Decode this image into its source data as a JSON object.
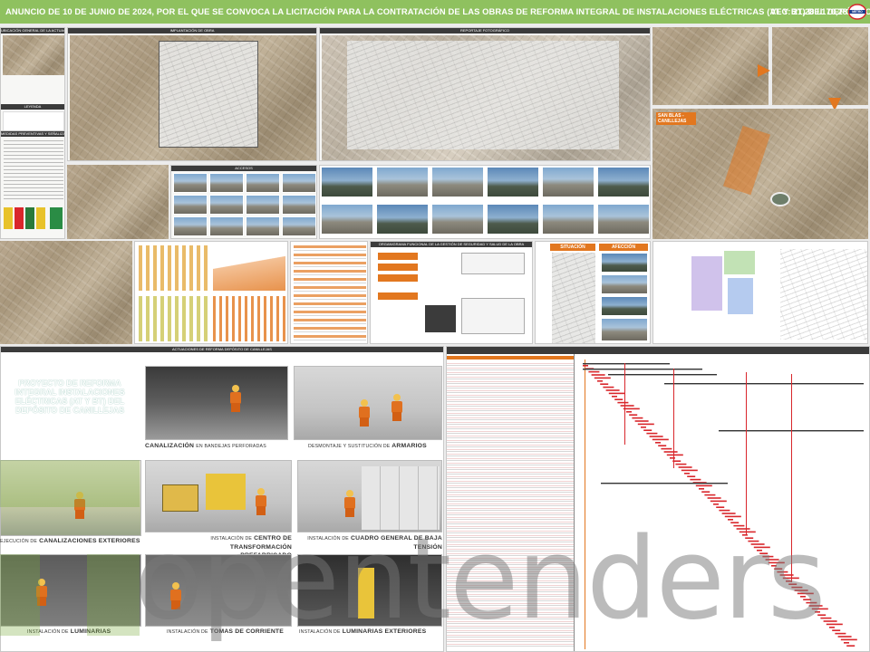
{
  "header": {
    "title": "ANUNCIO DE 10 DE JUNIO DE 2024, POR EL QUE SE CONVOCA LA LICITACIÓN PARA LA CONTRATACIÓN DE LAS OBRAS DE REFORMA INTEGRAL DE INSTALACIONES ELÉCTRICAS (AT Y BT) DEL DEPÓSITO DE CANILLEJAS",
    "vec": "VEC: 21.289.170,28 €",
    "brand_color": "#8fc15f",
    "accent_color": "#e2771f",
    "logo_icon": "metro-madrid-logo"
  },
  "panels": {
    "location_title": "UBICACIÓN GENERAL DE LA ACTUACIÓN",
    "implantation_title": "IMPLANTACIÓN DE OBRA",
    "photo_report_title": "REPORTAJE FOTOGRÁFICO",
    "access_title": "ACCESOS",
    "org_title": "ORGANIGRAMA FUNCIONAL DE LA GESTIÓN DE SEGURIDAD Y SALUD DE LA OBRA",
    "situation_title": "SITUACIÓN",
    "affection_title": "AFECCIÓN",
    "actuations_title": "ACTUACIONES DE REFORMA DEPÓSITO DE CANILLEJAS",
    "legend_title": "LEYENDA",
    "signage_title": "MEDIDAS PREVENTIVAS Y SEÑALIZACIÓN"
  },
  "map_labels": {
    "san_blas": "SAN BLAS - CANILLEJAS"
  },
  "project": {
    "title": "PROYECTO DE REFORMA INTEGRAL INSTALACIONES ELÉCTRICAS (AT Y BT) DEL DEPÓSITO DE CANILLEJAS"
  },
  "works": [
    {
      "prefix": "",
      "label": "CANALIZACIÓN",
      "suffix": "EN BANDEJAS PERFORADAS"
    },
    {
      "prefix": "DESMONTAJE Y SUSTITUCIÓN DE",
      "label": "ARMARIOS",
      "suffix": ""
    },
    {
      "prefix": "EJECUCIÓN DE",
      "label": "CANALIZACIONES EXTERIORES",
      "suffix": ""
    },
    {
      "prefix": "INSTALACIÓN DE",
      "label": "CENTRO DE TRANSFORMACIÓN PREFABRICADO",
      "suffix": ""
    },
    {
      "prefix": "INSTALACIÓN DE",
      "label": "CUADRO GENERAL DE BAJA TENSIÓN",
      "suffix": ""
    },
    {
      "prefix": "INSTALACIÓN DE",
      "label": "LUMINARIAS",
      "suffix": ""
    },
    {
      "prefix": "INSTALACIÓN DE",
      "label": "TOMAS DE CORRIENTE",
      "suffix": ""
    },
    {
      "prefix": "INSTALACIÓN DE",
      "label": "LUMINARIAS EXTERIORES",
      "suffix": ""
    }
  ],
  "watermark": {
    "text": "opentenders"
  }
}
